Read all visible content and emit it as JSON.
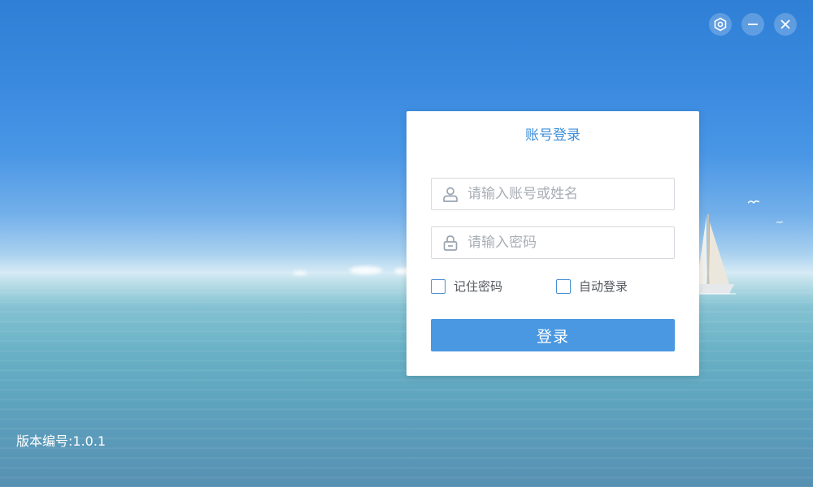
{
  "window": {
    "controls": [
      {
        "icon": "settings-icon"
      },
      {
        "icon": "minimize-icon"
      },
      {
        "icon": "close-icon"
      }
    ]
  },
  "login": {
    "title": "账号登录",
    "account": {
      "icon": "user-icon",
      "value": "",
      "placeholder": "请输入账号或姓名"
    },
    "password": {
      "icon": "lock-icon",
      "value": "",
      "placeholder": "请输入密码"
    },
    "remember": {
      "label": "记住密码",
      "checked": false
    },
    "auto_login": {
      "label": "自动登录",
      "checked": false
    },
    "submit_label": "登录"
  },
  "footer": {
    "version": "版本编号:1.0.1"
  },
  "colors": {
    "accent": "#4a98e2",
    "title": "#3d8fd9"
  }
}
